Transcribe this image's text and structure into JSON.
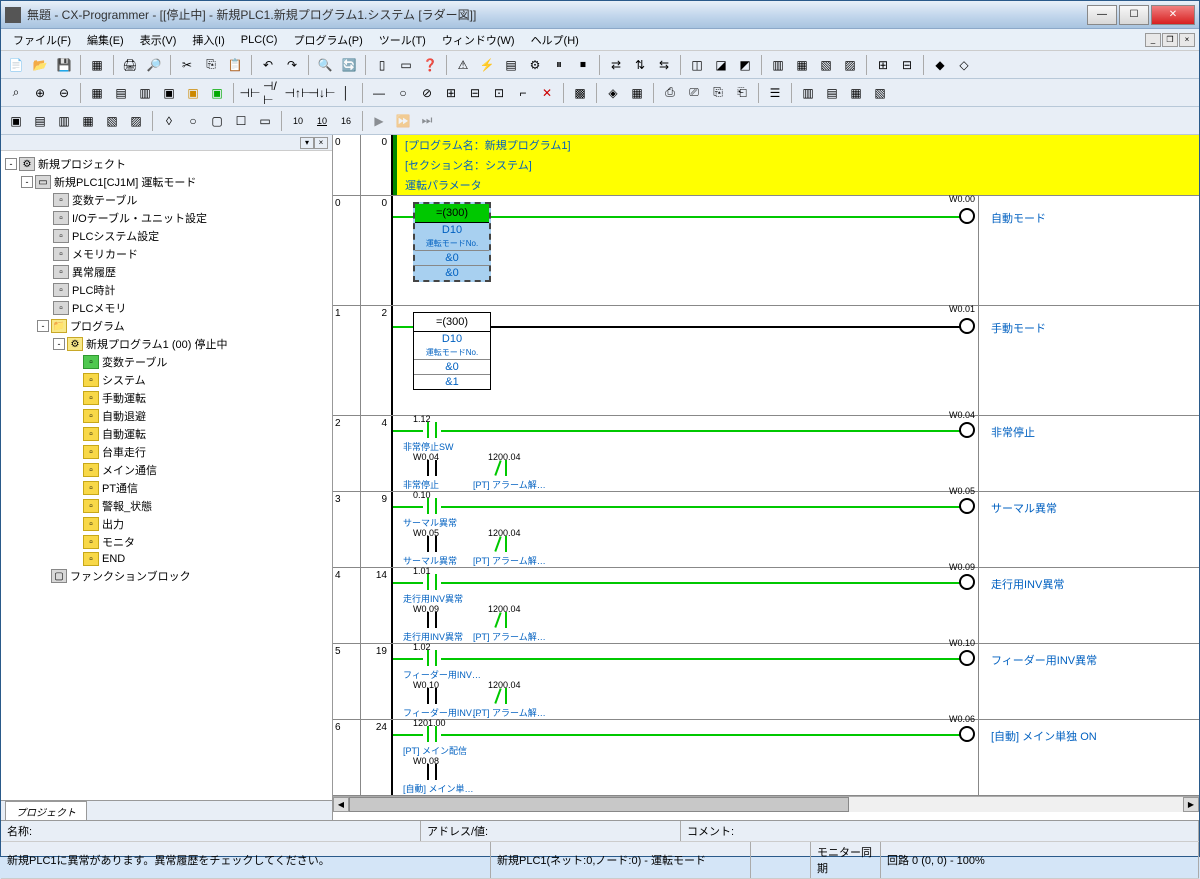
{
  "title": "無題 - CX-Programmer - [[停止中] - 新規PLC1.新規プログラム1.システム [ラダー図]]",
  "menu": {
    "file": "ファイル(F)",
    "edit": "編集(E)",
    "view": "表示(V)",
    "insert": "挿入(I)",
    "plc": "PLC(C)",
    "program": "プログラム(P)",
    "tool": "ツール(T)",
    "window": "ウィンドウ(W)",
    "help": "ヘルプ(H)"
  },
  "tree": {
    "root": "新規プロジェクト",
    "plc": "新規PLC1[CJ1M] 運転モード",
    "items": [
      "変数テーブル",
      "I/Oテーブル・ユニット設定",
      "PLCシステム設定",
      "メモリカード",
      "異常履歴",
      "PLC時計",
      "PLCメモリ"
    ],
    "program_root": "プログラム",
    "program": "新規プログラム1 (00) 停止中",
    "sections": [
      "変数テーブル",
      "システム",
      "手動運転",
      "自動退避",
      "自動運転",
      "台車走行",
      "メイン通信",
      "PT通信",
      "警報_状態",
      "出力",
      "モニタ",
      "END"
    ],
    "fb": "ファンクションブロック",
    "tab": "プロジェクト"
  },
  "ladder": {
    "header": {
      "prog": "[プログラム名：新規プログラム1]",
      "section": "[セクション名：システム]",
      "param": "運転パラメータ"
    },
    "rungs": [
      {
        "n": "0",
        "s": "0",
        "cmp": {
          "op": "=(300)",
          "a": "D10",
          "c": "運転モードNo.",
          "v1": "&0",
          "v2": "&0"
        },
        "coil": "W0.00",
        "comment": "自動モード",
        "selected": true
      },
      {
        "n": "1",
        "s": "2",
        "cmp": {
          "op": "=(300)",
          "a": "D10",
          "c": "運転モードNo.",
          "v1": "&0",
          "v2": "&1"
        },
        "coil": "W0.01",
        "comment": "手動モード",
        "selected": false
      },
      {
        "n": "2",
        "s": "4",
        "c1_addr": "1.12",
        "c1_lbl": "非常停止SW",
        "c2_addr": "W0.04",
        "c3_addr": "1200.04",
        "c2_lbl": "非常停止",
        "c3_lbl": "[PT] アラーム解…",
        "coil": "W0.04",
        "comment": "非常停止"
      },
      {
        "n": "3",
        "s": "9",
        "c1_addr": "0.10",
        "c1_lbl": "サーマル異常",
        "c2_addr": "W0.05",
        "c3_addr": "1200.04",
        "c2_lbl": "サーマル異常",
        "c3_lbl": "[PT] アラーム解…",
        "coil": "W0.05",
        "comment": "サーマル異常"
      },
      {
        "n": "4",
        "s": "14",
        "c1_addr": "1.01",
        "c1_lbl": "走行用INV異常",
        "c2_addr": "W0.09",
        "c3_addr": "1200.04",
        "c2_lbl": "走行用INV異常",
        "c3_lbl": "[PT] アラーム解…",
        "coil": "W0.09",
        "comment": "走行用INV異常"
      },
      {
        "n": "5",
        "s": "19",
        "c1_addr": "1.02",
        "c1_lbl": "フィーダー用INV…",
        "c2_addr": "W0.10",
        "c3_addr": "1200.04",
        "c2_lbl": "フィーダー用INV…",
        "c3_lbl": "[PT] アラーム解…",
        "coil": "W0.10",
        "comment": "フィーダー用INV異常"
      },
      {
        "n": "6",
        "s": "24",
        "c1_addr": "1201.00",
        "c1_lbl": "[PT] メイン配信",
        "c2_addr": "W0.08",
        "c2_lbl": "[自動] メイン単…",
        "coil": "W0.06",
        "comment": "[自動] メイン単独 ON"
      }
    ]
  },
  "status": {
    "name_lbl": "名称:",
    "addr_lbl": "アドレス/値:",
    "comment_lbl": "コメント:",
    "msg": "新規PLC1に異常があります。異常履歴をチェックしてください。",
    "plc_info": "新規PLC1(ネット:0,ノード:0) - 運転モード",
    "sync": "モニター同期",
    "pos": "回路 0 (0, 0) - 100%"
  }
}
